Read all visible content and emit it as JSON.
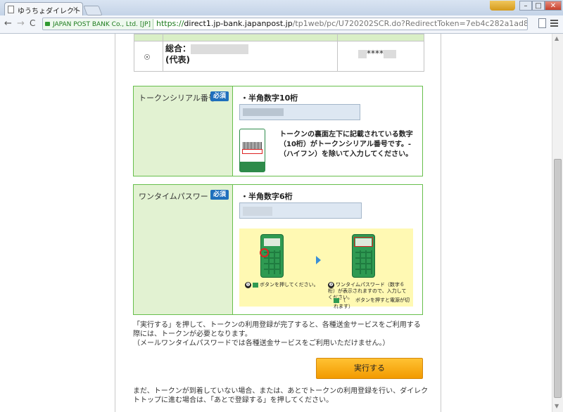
{
  "browser": {
    "tab_title": "ゆうちょダイレクト | ト",
    "tab_close": "×",
    "profile_badge": "",
    "window_min": "–",
    "window_max": "□",
    "window_close": "✕",
    "back": "←",
    "forward": "→",
    "reload": "C",
    "ev_label": "JAPAN POST BANK Co., Ltd. [JP]",
    "url_scheme": "https://",
    "url_host": "direct1.jp-bank.japanpost.jp",
    "url_rest": "/tp1web/pc/U720202SCR.do?RedirectToken=7eb4c282a1ad846979c1151786af1f17"
  },
  "account_table": {
    "name_prefix": "総合：",
    "name_suffix": "(代表)",
    "masked_number": "****"
  },
  "serial_section": {
    "label": "トークンシリアル番号",
    "required": "必須",
    "note": "・半角数字10桁",
    "description": "トークンの裏面左下に記載されている数字（10桁）がトークンシリアル番号です。-（ハイフン）を除いて入力してください。"
  },
  "otp_section": {
    "label": "ワンタイムパスワード",
    "required": "必須",
    "note": "・半角数字6桁",
    "step1_num": "❶",
    "step1_text": "ボタンを押してください。",
    "step2_num": "❷",
    "step2_text": "ワンタイムパスワード（数字６桁）が表示されますので、入力してください。",
    "power_note": "（　　ボタンを押すと電源が切れます）"
  },
  "notice_text": "「実行する」を押して、トークンの利用登録が完了すると、各種送金サービスをご利用する際には、トークンが必要となります。\n（メールワンタイムパスワードでは各種送金サービスをご利用いただけません。）",
  "execute_button": "実行する",
  "footer_text": "まだ、トークンが到着していない場合、または、あとでトークンの利用登録を行い、ダイレクトトップに進む場合は、「あとで登録する」を押してください。",
  "colors": {
    "section_border": "#67bf4c",
    "label_bg": "#e2f2d2",
    "required_badge": "#1f6fbc",
    "execute_button": "#f5a300"
  }
}
